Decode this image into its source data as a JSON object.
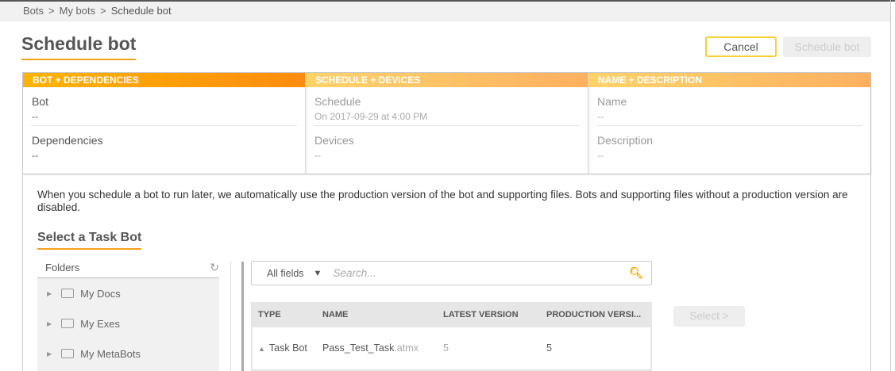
{
  "breadcrumb": [
    "Bots",
    "My bots",
    "Schedule bot"
  ],
  "page_title": "Schedule bot",
  "buttons": {
    "cancel": "Cancel",
    "schedule": "Schedule bot",
    "select": "Select >"
  },
  "cards": [
    {
      "header": "BOT + DEPENDENCIES",
      "fields": [
        {
          "label": "Bot",
          "value": "--"
        },
        {
          "label": "Dependencies",
          "value": "--"
        }
      ]
    },
    {
      "header": "SCHEDULE + DEVICES",
      "fields": [
        {
          "label": "Schedule",
          "value": "On 2017-09-29 at 4:00 PM"
        },
        {
          "label": "Devices",
          "value": "--"
        }
      ]
    },
    {
      "header": "NAME + DESCRIPTION",
      "fields": [
        {
          "label": "Name",
          "value": "--"
        },
        {
          "label": "Description",
          "value": "--"
        }
      ]
    }
  ],
  "info": "When you schedule a bot to run later, we automatically use the production version of the bot and supporting files. Bots and supporting files without a production version are disabled.",
  "section_title": "Select a Task Bot",
  "folders": {
    "header": "Folders",
    "items": [
      "My Docs",
      "My Exes",
      "My MetaBots"
    ]
  },
  "search": {
    "field": "All fields",
    "placeholder": "Search..."
  },
  "table": {
    "columns": [
      "TYPE",
      "NAME",
      "LATEST VERSION",
      "PRODUCTION VERSI..."
    ],
    "rows": [
      {
        "type": "Task Bot",
        "name": "Pass_Test_Task",
        "ext": ".atmx",
        "latest": "5",
        "production": "5"
      }
    ]
  },
  "colors": {
    "accent": "#f7a11a",
    "cancel_border": "#ffcc33",
    "search_icon": "#f7a800"
  }
}
